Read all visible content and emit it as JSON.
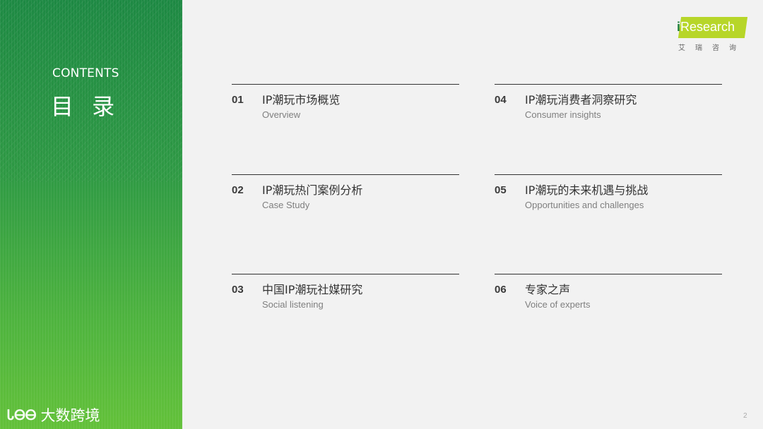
{
  "sidebar": {
    "heading_en": "CONTENTS",
    "heading_zh": "目 录",
    "footer_logo_mark": "ᏓᎾᎾ",
    "footer_logo_text": "大数跨境"
  },
  "brand": {
    "logo_i": "i",
    "logo_word": "Research",
    "logo_sub": "艾瑞咨询",
    "accent_color": "#b7d629"
  },
  "toc": [
    {
      "num": "01",
      "title": "IP潮玩市场概览",
      "subtitle": "Overview"
    },
    {
      "num": "02",
      "title": "IP潮玩热门案例分析",
      "subtitle": "Case Study"
    },
    {
      "num": "03",
      "title": "中国IP潮玩社媒研究",
      "subtitle": "Social listening"
    },
    {
      "num": "04",
      "title": "IP潮玩消费者洞察研究",
      "subtitle": "Consumer insights"
    },
    {
      "num": "05",
      "title": "IP潮玩的未来机遇与挑战",
      "subtitle": "Opportunities and challenges"
    },
    {
      "num": "06",
      "title": "专家之声",
      "subtitle": "Voice of experts"
    }
  ],
  "page_number": "2"
}
